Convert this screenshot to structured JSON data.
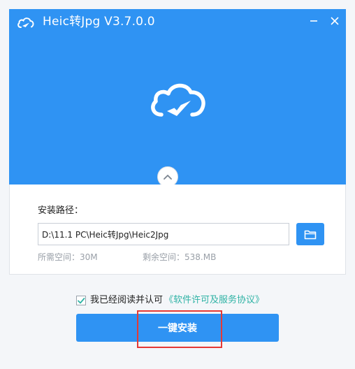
{
  "window": {
    "title": "Heic转Jpg V3.7.0.0",
    "minimize_icon": "minimize-icon",
    "close_icon": "close-icon"
  },
  "header": {
    "logo_icon": "cloud-logo-icon",
    "background_color": "#2f93f3"
  },
  "collapse": {
    "icon": "chevron-up-icon"
  },
  "install_path": {
    "label": "安装路径：",
    "value": "D:\\11.1 PC\\Heic转Jpg\\Heic2Jpg",
    "browse_icon": "folder-icon"
  },
  "disk_space": {
    "required": "所需空间：30M",
    "remaining": "剩余空间：538.MB"
  },
  "agreement": {
    "checked": true,
    "text": "我已经阅读并认可",
    "link": "《软件许可及服务协议》",
    "link_color": "#2fb3a5"
  },
  "install_button": {
    "label": "一键安装"
  },
  "colors": {
    "accent": "#2f93f3",
    "highlight": "#e53935"
  }
}
